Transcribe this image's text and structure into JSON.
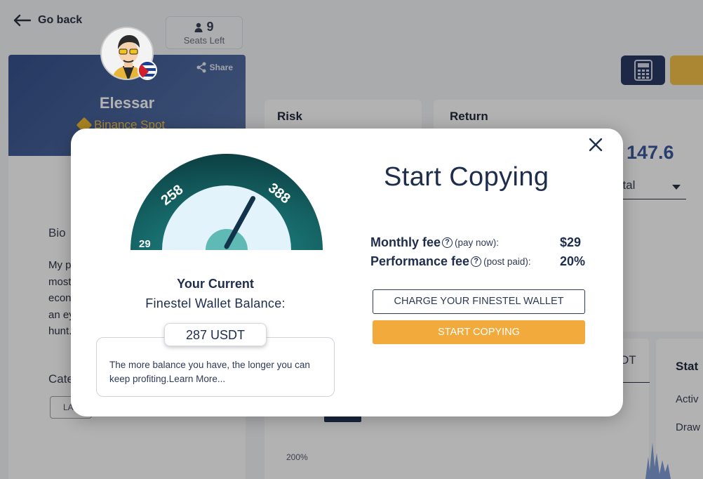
{
  "header": {
    "go_back": "Go back",
    "seats_count": "9",
    "seats_label": "Seats Left"
  },
  "profile": {
    "share": "Share",
    "name": "Elessar",
    "exchange": "Binance Spot",
    "bio_heading": "Bio",
    "bio_lines": [
      "My po",
      "mostl",
      "econo",
      "an ey",
      "hunt."
    ],
    "categories_heading": "Cate",
    "category_chip": "LAR"
  },
  "background": {
    "risk_title": "Risk",
    "return_title": "Return",
    "return_value": "147.6",
    "total_select": "otal",
    "usdt_tab": "DT",
    "stats_title": "Stat",
    "stats_active": "Activ",
    "stats_drawdown": "Draw",
    "chart_percent": "200%"
  },
  "modal": {
    "gauge": {
      "min_label": "29",
      "mid_label": "258",
      "max_label": "388",
      "needle_fraction": 0.66
    },
    "balance_title": "Your Current",
    "balance_subtitle": "Finestel Wallet Balance:",
    "balance_value": "287 USDT",
    "info_text": "The more balance you have, the longer you can keep profiting.Learn More...",
    "title": "Start Copying",
    "monthly_fee_label": "Monthly fee",
    "monthly_fee_note": "(pay now):",
    "monthly_fee_value": "$29",
    "performance_fee_label": "Performance fee",
    "performance_fee_note": "(post paid):",
    "performance_fee_value": "20%",
    "charge_button": "CHARGE YOUR FINESTEL WALLET",
    "start_button": "START COPYING",
    "help_glyph": "?"
  },
  "colors": {
    "accent_orange": "#f3aa3c",
    "gauge_dark": "#0f4a4e",
    "navy": "#1f2d4d"
  }
}
